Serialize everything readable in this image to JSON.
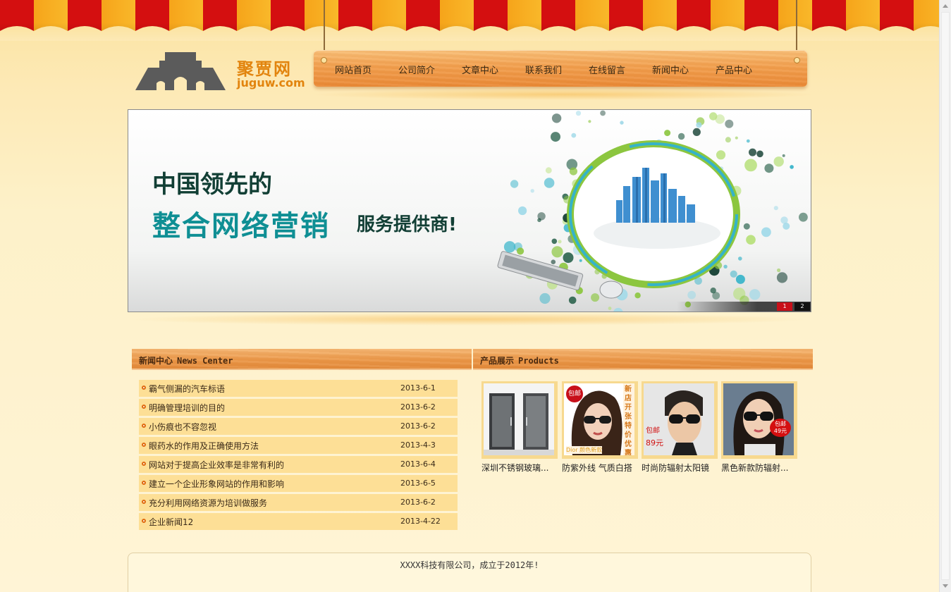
{
  "site": {
    "logo_cn": "聚贾网",
    "logo_en": "juguw.com"
  },
  "nav": {
    "items": [
      {
        "label": "网站首页"
      },
      {
        "label": "公司简介"
      },
      {
        "label": "文章中心"
      },
      {
        "label": "联系我们"
      },
      {
        "label": "在线留言"
      },
      {
        "label": "新闻中心"
      },
      {
        "label": "产品中心"
      }
    ]
  },
  "banner": {
    "line1": "中国领先的",
    "line2": "整合网络营销",
    "line3": "服务提供商!",
    "slides": [
      "1",
      "2"
    ],
    "active_slide": 1,
    "colors": {
      "dark": "#123f35",
      "teal": "#0f8f94",
      "active": "#c8101a"
    }
  },
  "news": {
    "title": "新闻中心",
    "subtitle": "News Center",
    "items": [
      {
        "title": "霸气侧漏的汽车标语",
        "date": "2013-6-1"
      },
      {
        "title": "明确管理培训的目的",
        "date": "2013-6-2"
      },
      {
        "title": "小伤痕也不容忽视",
        "date": "2013-6-2"
      },
      {
        "title": "眼药水的作用及正确使用方法",
        "date": "2013-4-3"
      },
      {
        "title": "网站对于提高企业效率是非常有利的",
        "date": "2013-6-4"
      },
      {
        "title": "建立一个企业形象网站的作用和影响",
        "date": "2013-6-5"
      },
      {
        "title": "充分利用网络资源为培训做服务",
        "date": "2013-6-2"
      },
      {
        "title": "企业新闻12",
        "date": "2013-4-22"
      }
    ]
  },
  "products": {
    "title": "产品展示",
    "subtitle": "Products",
    "items": [
      {
        "name": "深圳不锈钢玻璃...",
        "badge": ""
      },
      {
        "name": "防紫外线 气质白搭",
        "badge": "包邮",
        "side_text": "新店开张 特价优惠",
        "corner_text": "Dior 颜色新款"
      },
      {
        "name": "时尚防辐射太阳镜",
        "badge": "包邮",
        "price": "89元"
      },
      {
        "name": "黑色新款防辐射...",
        "badge": "包邮",
        "price": "49元"
      }
    ]
  },
  "footer": {
    "text": "XXXX科技有限公司，成立于2012年!"
  }
}
